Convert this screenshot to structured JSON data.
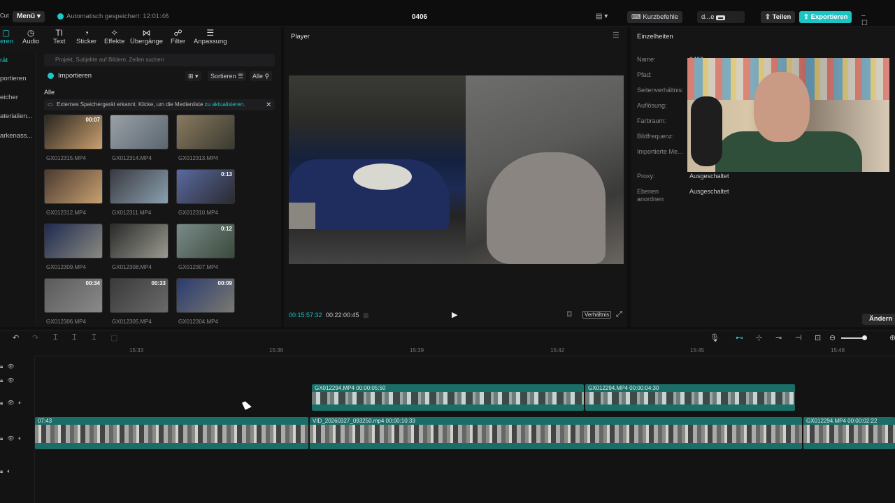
{
  "topbar": {
    "app_frag": "Cut",
    "menu_label": "Menü ▾",
    "autosave_text": "Automatisch gespeichert: 12:01:46",
    "project_title": "0406",
    "shortcuts_label": "Kurzbefehle",
    "user_label": "d...e",
    "share_label": "Teilen",
    "export_label": "Exportieren"
  },
  "tools": [
    {
      "label": "ieren",
      "icon": "import-icon"
    },
    {
      "label": "Audio",
      "icon": "audio-icon"
    },
    {
      "label": "Text",
      "icon": "text-icon"
    },
    {
      "label": "Sticker",
      "icon": "sticker-icon"
    },
    {
      "label": "Effekte",
      "icon": "effects-icon"
    },
    {
      "label": "Übergänge",
      "icon": "transitions-icon"
    },
    {
      "label": "Filter",
      "icon": "filter-icon"
    },
    {
      "label": "Anpassung",
      "icon": "adjust-icon"
    }
  ],
  "side_items": [
    "rät",
    "portieren",
    "eicher",
    "aterialien...",
    "arkenass..."
  ],
  "media": {
    "search_placeholder": "Projekt, Subjekte auf Bildern, Zeilen suchen",
    "import_label": "Importieren",
    "sort_label": "Sortieren",
    "all_filter_label": "Alle",
    "all_label": "Alle",
    "notice_text": "Externes Speichergerät erkannt. Klicke, um die Medienliste ",
    "notice_link": "zu aktualisieren.",
    "items": [
      {
        "name": "GX012315.MP4",
        "duration": "00:07"
      },
      {
        "name": "GX012314.MP4",
        "duration": ""
      },
      {
        "name": "GX012313.MP4",
        "duration": ""
      },
      {
        "name": "GX012312.MP4",
        "duration": ""
      },
      {
        "name": "GX012311.MP4",
        "duration": ""
      },
      {
        "name": "GX012310.MP4",
        "duration": "0:13"
      },
      {
        "name": "GX012309.MP4",
        "duration": ""
      },
      {
        "name": "GX012308.MP4",
        "duration": ""
      },
      {
        "name": "GX012307.MP4",
        "duration": "0:12"
      },
      {
        "name": "GX012306.MP4",
        "duration": "00:34"
      },
      {
        "name": "GX012305.MP4",
        "duration": "00:33"
      },
      {
        "name": "GX012304.MP4",
        "duration": "00:09"
      }
    ]
  },
  "player": {
    "title": "Player",
    "current_time": "00:15:57:32",
    "total_time": "00:22:00:45",
    "ratio_label": "Verhältnis"
  },
  "details": {
    "title": "Einzelheiten",
    "fields": [
      {
        "label": "Name:",
        "value": "0406"
      },
      {
        "label": "Pfad:",
        "value": ""
      },
      {
        "label": "Seitenverhältnis:",
        "value": ""
      },
      {
        "label": "Auflösung:",
        "value": ""
      },
      {
        "label": "Farbraum:",
        "value": ""
      },
      {
        "label": "Bildfrequenz:",
        "value": ""
      },
      {
        "label": "Importierte Me...",
        "value": ""
      },
      {
        "label": "Proxy:",
        "value": "Ausgeschaltet"
      },
      {
        "label": "Ebenen anordnen",
        "value": "Ausgeschaltet"
      }
    ],
    "change_label": "Ändern"
  },
  "timeline": {
    "ticks": [
      "15:33",
      "15:36",
      "15:39",
      "15:42",
      "15:45",
      "15:48"
    ],
    "clips": [
      {
        "label": "GX012294.MP4   00:00:05:50",
        "track": "upper"
      },
      {
        "label": "GX012294.MP4   00:00:04:30",
        "track": "upper"
      },
      {
        "label": "07:43",
        "track": "main"
      },
      {
        "label": "VID_20260327_093250.mp4   00:00:10:33",
        "track": "main"
      },
      {
        "label": "GX012294.MP4   00:00:02:22",
        "track": "main"
      }
    ]
  },
  "colors": {
    "accent": "#1cc4c4",
    "clip": "#1a6e68"
  }
}
